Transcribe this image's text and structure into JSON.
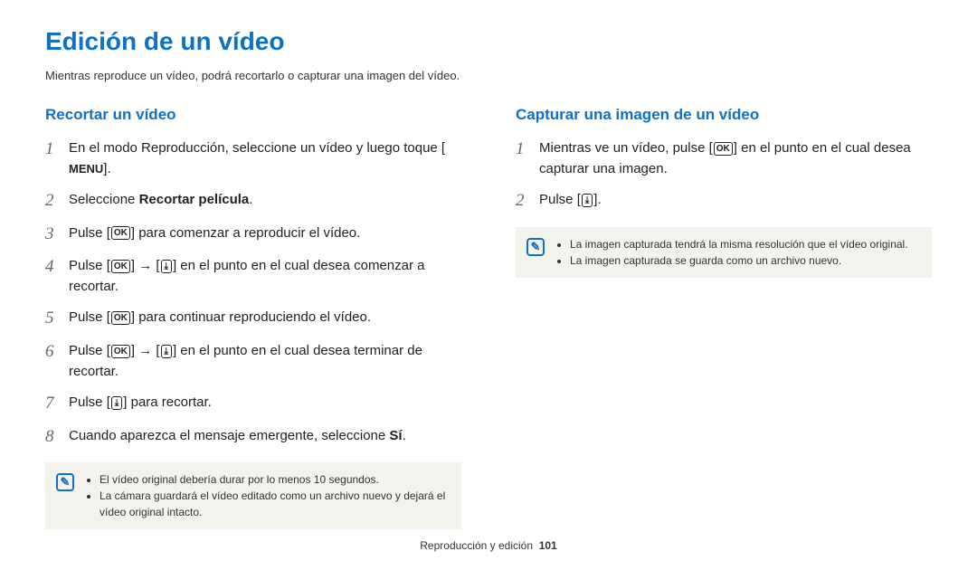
{
  "title": "Edición de un vídeo",
  "intro": "Mientras reproduce un vídeo, podrá recortarlo o capturar una imagen del vídeo.",
  "left": {
    "heading": "Recortar un vídeo",
    "step1_a": "En el modo Reproducción, seleccione un vídeo y luego toque [",
    "step1_b": "].",
    "menu_label": "MENU",
    "step2_a": "Seleccione ",
    "step2_b": "Recortar película",
    "step2_c": ".",
    "step3_a": "Pulse [",
    "step3_b": "] para comenzar a reproducir el vídeo.",
    "step4_a": "Pulse [",
    "step4_b": "] → [",
    "step4_c": "] en el punto en el cual desea comenzar a recortar.",
    "step5_a": "Pulse [",
    "step5_b": "] para continuar reproduciendo el vídeo.",
    "step6_a": "Pulse [",
    "step6_b": "] → [",
    "step6_c": "] en el punto en el cual desea terminar de recortar.",
    "step7_a": "Pulse [",
    "step7_b": "] para recortar.",
    "step8_a": "Cuando aparezca el mensaje emergente, seleccione ",
    "step8_b": "Sí",
    "step8_c": ".",
    "note1": "El vídeo original debería durar por lo menos 10 segundos.",
    "note2": "La cámara guardará el vídeo editado como un archivo nuevo y dejará el vídeo original intacto."
  },
  "right": {
    "heading": "Capturar una imagen de un vídeo",
    "step1_a": "Mientras ve un vídeo, pulse [",
    "step1_b": "] en el punto en el cual desea capturar una imagen.",
    "step2_a": "Pulse [",
    "step2_b": "].",
    "note1": "La imagen capturada tendrá la misma resolución que el vídeo original.",
    "note2": "La imagen capturada se guarda como un archivo nuevo."
  },
  "footer": {
    "section": "Reproducción y edición",
    "page": "101"
  },
  "ok_label": "OK",
  "down_glyph": "⤓"
}
